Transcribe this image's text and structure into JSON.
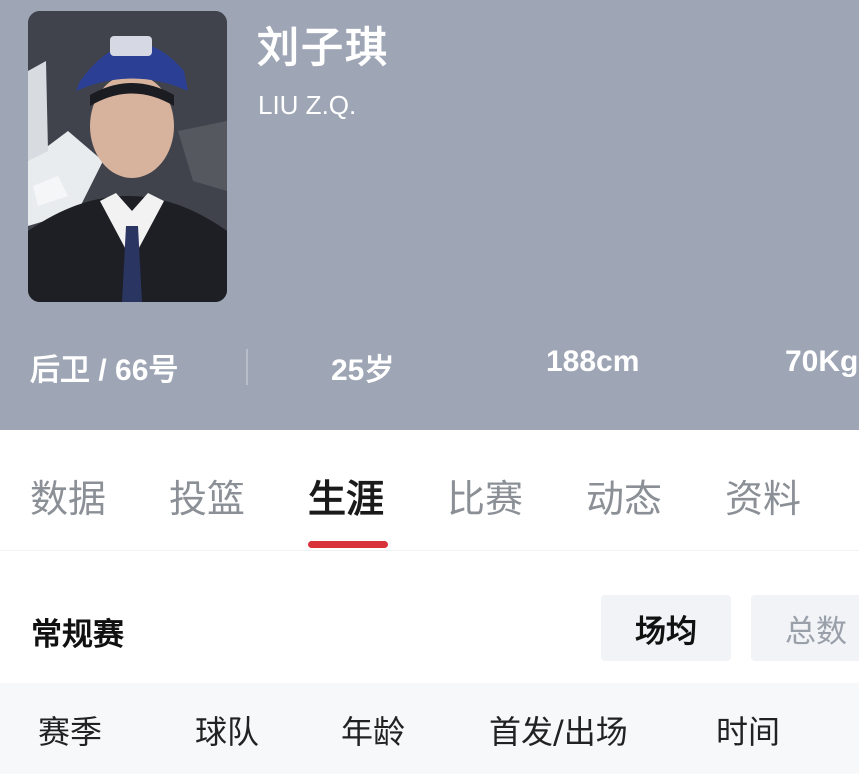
{
  "player": {
    "name_cn": "刘子琪",
    "name_en": "LIU Z.Q.",
    "position_number": "后卫 / 66号",
    "age": "25岁",
    "height": "188cm",
    "weight": "70Kg"
  },
  "tabs": [
    {
      "label": "数据",
      "active": false
    },
    {
      "label": "投篮",
      "active": false
    },
    {
      "label": "生涯",
      "active": true
    },
    {
      "label": "比赛",
      "active": false
    },
    {
      "label": "动态",
      "active": false
    },
    {
      "label": "资料",
      "active": false
    }
  ],
  "section": {
    "title": "常规赛",
    "toggle": [
      "场均",
      "总数"
    ],
    "toggle_selected": "场均"
  },
  "table": {
    "columns": [
      "赛季",
      "球队",
      "年龄",
      "首发/出场",
      "时间"
    ]
  },
  "colors": {
    "header_bg": "#9ea5b4",
    "accent": "#d8333a"
  }
}
